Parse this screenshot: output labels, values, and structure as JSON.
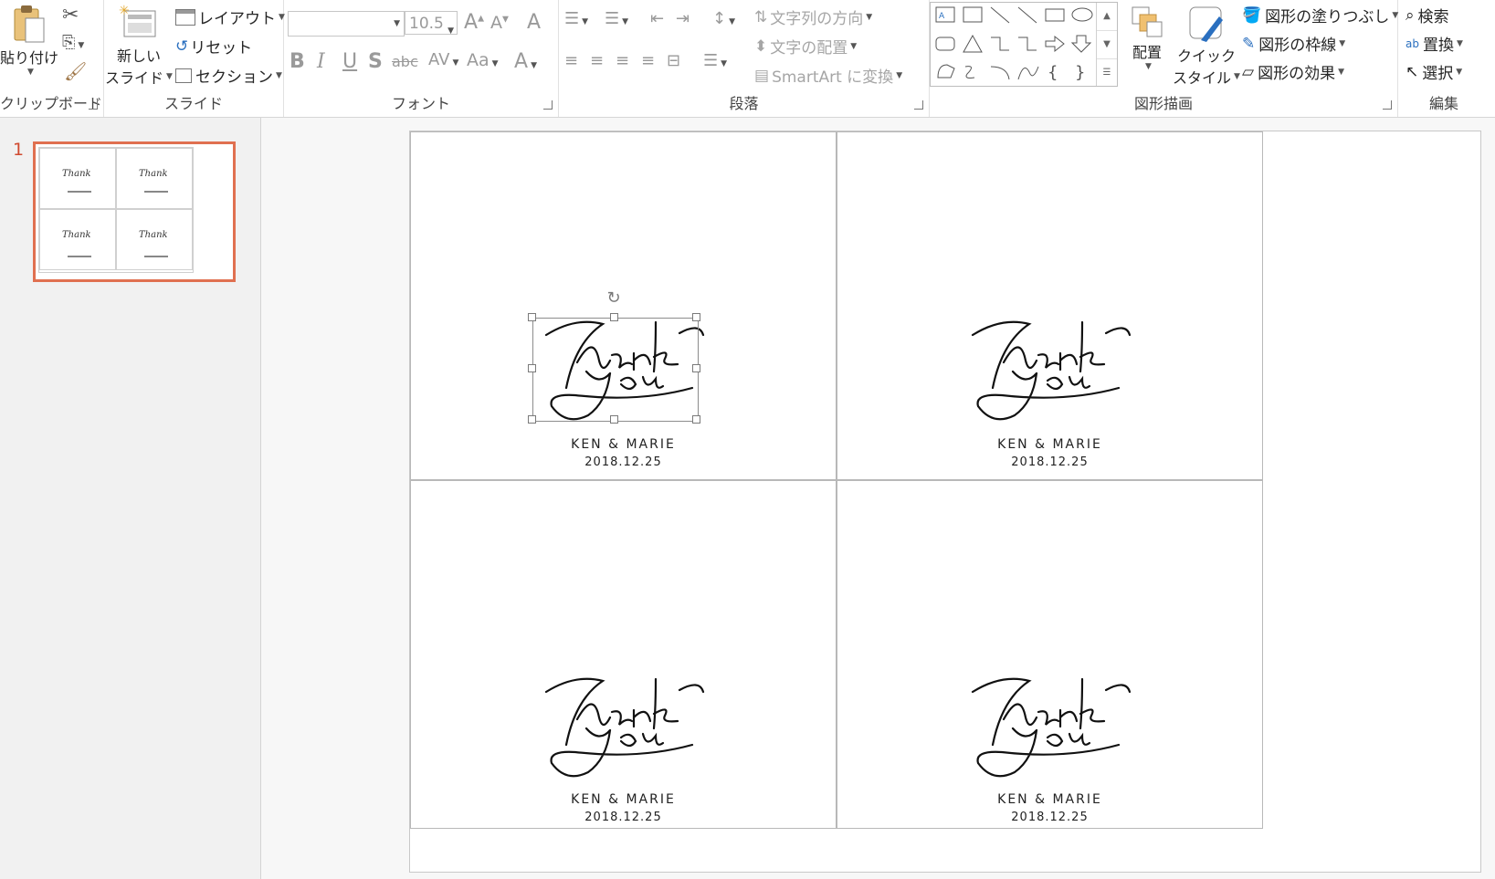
{
  "clipboard": {
    "group_label": "クリップボード",
    "paste_label": "貼り付け"
  },
  "slides": {
    "group_label": "スライド",
    "new_slide_line1": "新しい",
    "new_slide_line2": "スライド",
    "layout_label": "レイアウト",
    "reset_label": "リセット",
    "section_label": "セクション"
  },
  "font": {
    "group_label": "フォント",
    "font_name": "",
    "font_size": "10.5"
  },
  "paragraph": {
    "group_label": "段落",
    "text_direction_label": "文字列の方向",
    "align_text_label": "文字の配置",
    "smartart_label": "SmartArt に変換"
  },
  "drawing": {
    "group_label": "図形描画",
    "arrange_label": "配置",
    "quick_style_line1": "クイック",
    "quick_style_line2": "スタイル",
    "fill_label": "図形の塗りつぶし",
    "outline_label": "図形の枠線",
    "effects_label": "図形の効果"
  },
  "editing": {
    "group_label": "編集",
    "find_label": "検索",
    "replace_label": "置換",
    "select_label": "選択"
  },
  "thumbnail": {
    "slide_number": "1"
  },
  "cards": [
    {
      "names": "KEN & MARIE",
      "date": "2018.12.25"
    },
    {
      "names": "KEN & MARIE",
      "date": "2018.12.25"
    },
    {
      "names": "KEN & MARIE",
      "date": "2018.12.25"
    },
    {
      "names": "KEN & MARIE",
      "date": "2018.12.25"
    }
  ],
  "colors": {
    "thumbnail_selection": "#e07050",
    "accent": "#d04a2f"
  }
}
